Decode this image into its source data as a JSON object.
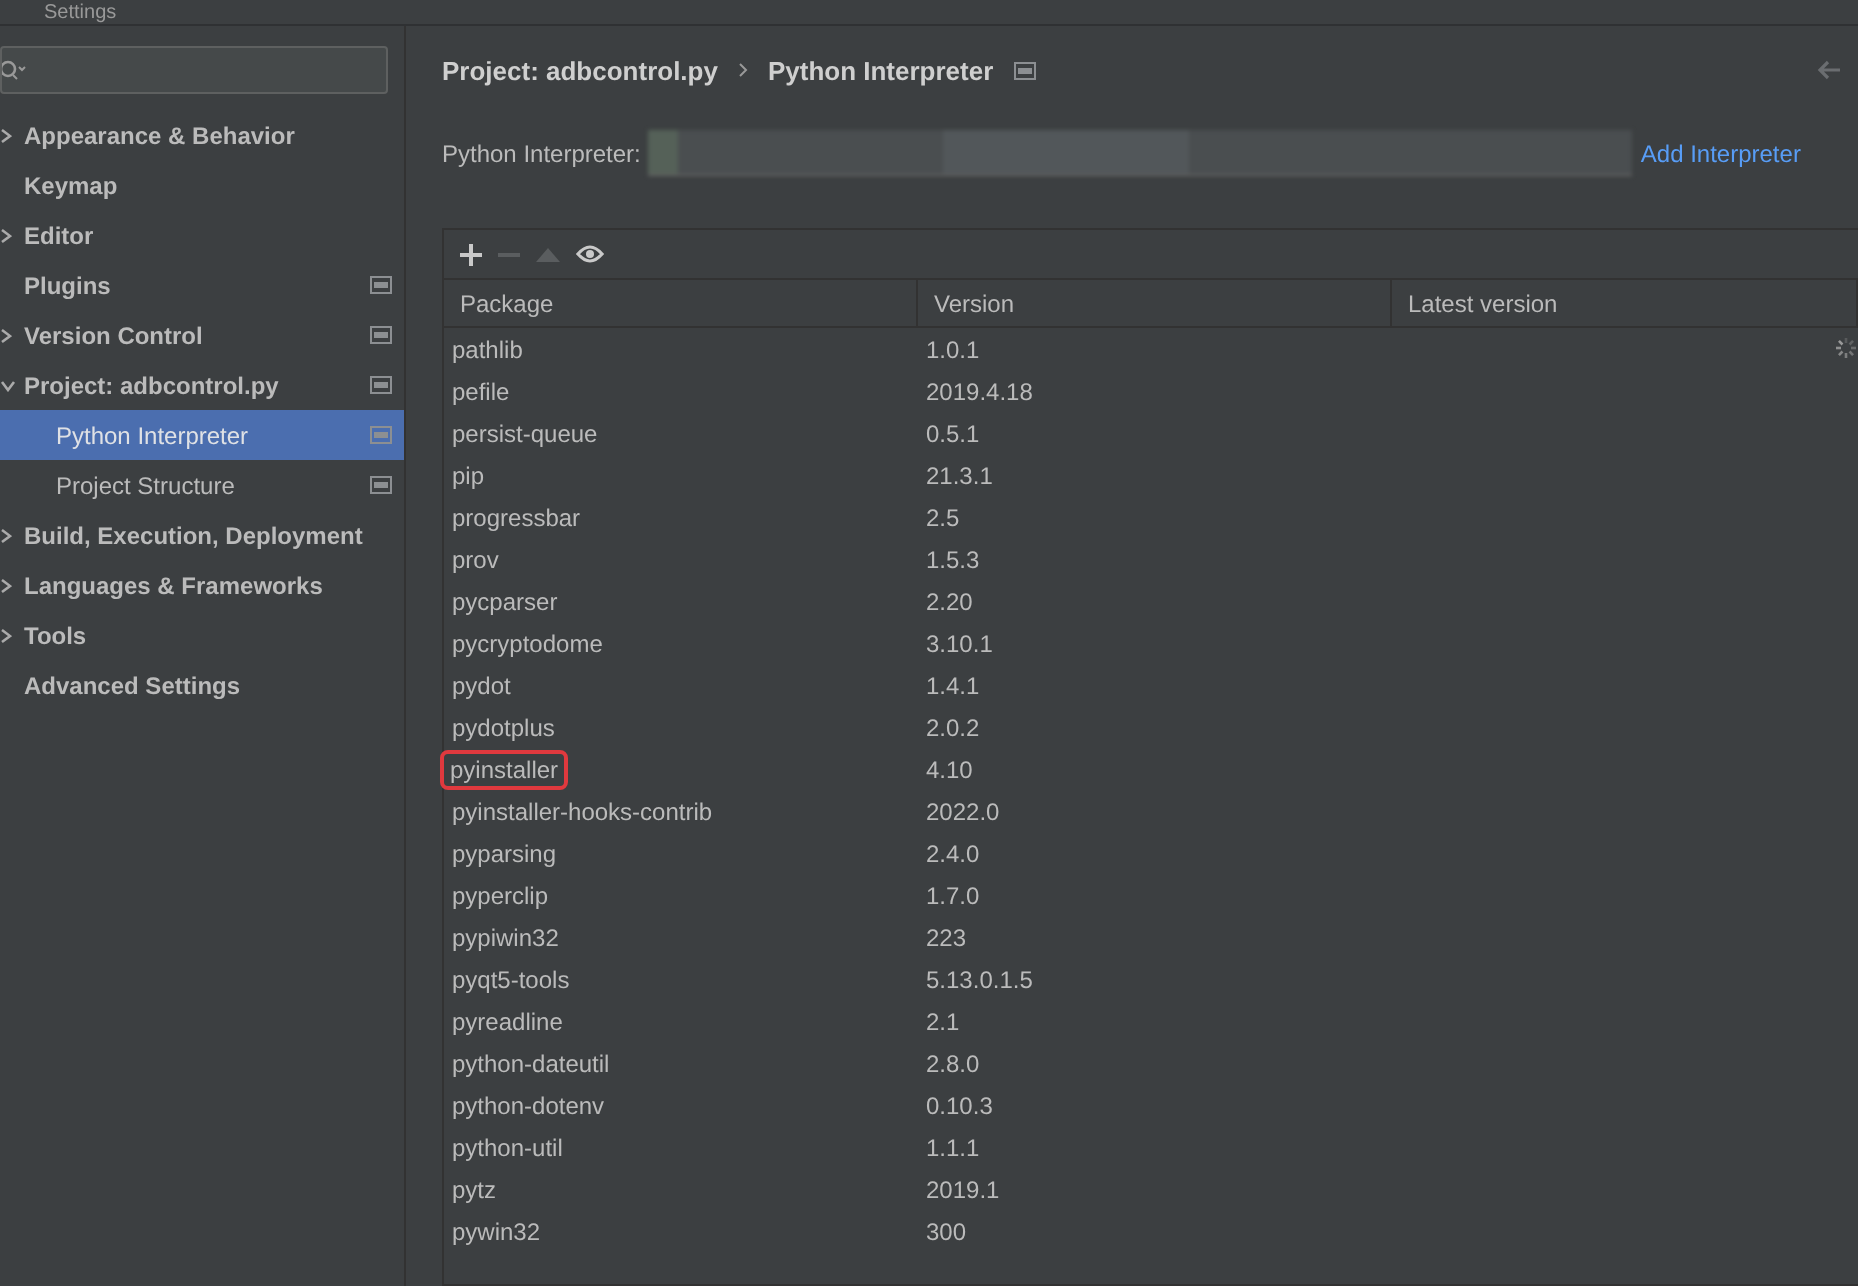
{
  "window": {
    "title": "Settings"
  },
  "sidebar": {
    "items": [
      {
        "kind": "group",
        "label": "Appearance & Behavior",
        "expanded": false,
        "scope_icon": false,
        "selected": false
      },
      {
        "kind": "page",
        "label": "Keymap",
        "scope_icon": false,
        "selected": false
      },
      {
        "kind": "group",
        "label": "Editor",
        "expanded": false,
        "scope_icon": false,
        "selected": false
      },
      {
        "kind": "page",
        "label": "Plugins",
        "scope_icon": true,
        "selected": false
      },
      {
        "kind": "group",
        "label": "Version Control",
        "expanded": false,
        "scope_icon": true,
        "selected": false
      },
      {
        "kind": "group",
        "label": "Project: adbcontrol.py",
        "expanded": true,
        "scope_icon": true,
        "selected": false,
        "children": [
          {
            "kind": "page",
            "label": "Python Interpreter",
            "scope_icon": true,
            "selected": true
          },
          {
            "kind": "page",
            "label": "Project Structure",
            "scope_icon": true,
            "selected": false
          }
        ]
      },
      {
        "kind": "group",
        "label": "Build, Execution, Deployment",
        "expanded": false,
        "scope_icon": false,
        "selected": false
      },
      {
        "kind": "group",
        "label": "Languages & Frameworks",
        "expanded": false,
        "scope_icon": false,
        "selected": false
      },
      {
        "kind": "group",
        "label": "Tools",
        "expanded": false,
        "scope_icon": false,
        "selected": false
      },
      {
        "kind": "page",
        "label": "Advanced Settings",
        "scope_icon": false,
        "selected": false
      }
    ]
  },
  "breadcrumb": [
    "Project: adbcontrol.py",
    "Python Interpreter"
  ],
  "interpreter": {
    "label": "Python Interpreter:",
    "add_link": "Add Interpreter"
  },
  "table": {
    "columns": [
      "Package",
      "Version",
      "Latest version"
    ],
    "loading": true,
    "rows": [
      {
        "package": "pathlib",
        "version": "1.0.1",
        "highlighted": false
      },
      {
        "package": "pefile",
        "version": "2019.4.18",
        "highlighted": false
      },
      {
        "package": "persist-queue",
        "version": "0.5.1",
        "highlighted": false
      },
      {
        "package": "pip",
        "version": "21.3.1",
        "highlighted": false
      },
      {
        "package": "progressbar",
        "version": "2.5",
        "highlighted": false
      },
      {
        "package": "prov",
        "version": "1.5.3",
        "highlighted": false
      },
      {
        "package": "pycparser",
        "version": "2.20",
        "highlighted": false
      },
      {
        "package": "pycryptodome",
        "version": "3.10.1",
        "highlighted": false
      },
      {
        "package": "pydot",
        "version": "1.4.1",
        "highlighted": false
      },
      {
        "package": "pydotplus",
        "version": "2.0.2",
        "highlighted": false
      },
      {
        "package": "pyinstaller",
        "version": "4.10",
        "highlighted": true
      },
      {
        "package": "pyinstaller-hooks-contrib",
        "version": "2022.0",
        "highlighted": false
      },
      {
        "package": "pyparsing",
        "version": "2.4.0",
        "highlighted": false
      },
      {
        "package": "pyperclip",
        "version": "1.7.0",
        "highlighted": false
      },
      {
        "package": "pypiwin32",
        "version": "223",
        "highlighted": false
      },
      {
        "package": "pyqt5-tools",
        "version": "5.13.0.1.5",
        "highlighted": false
      },
      {
        "package": "pyreadline",
        "version": "2.1",
        "highlighted": false
      },
      {
        "package": "python-dateutil",
        "version": "2.8.0",
        "highlighted": false
      },
      {
        "package": "python-dotenv",
        "version": "0.10.3",
        "highlighted": false
      },
      {
        "package": "python-util",
        "version": "1.1.1",
        "highlighted": false
      },
      {
        "package": "pytz",
        "version": "2019.1",
        "highlighted": false
      },
      {
        "package": "pywin32",
        "version": "300",
        "highlighted": false
      }
    ]
  }
}
